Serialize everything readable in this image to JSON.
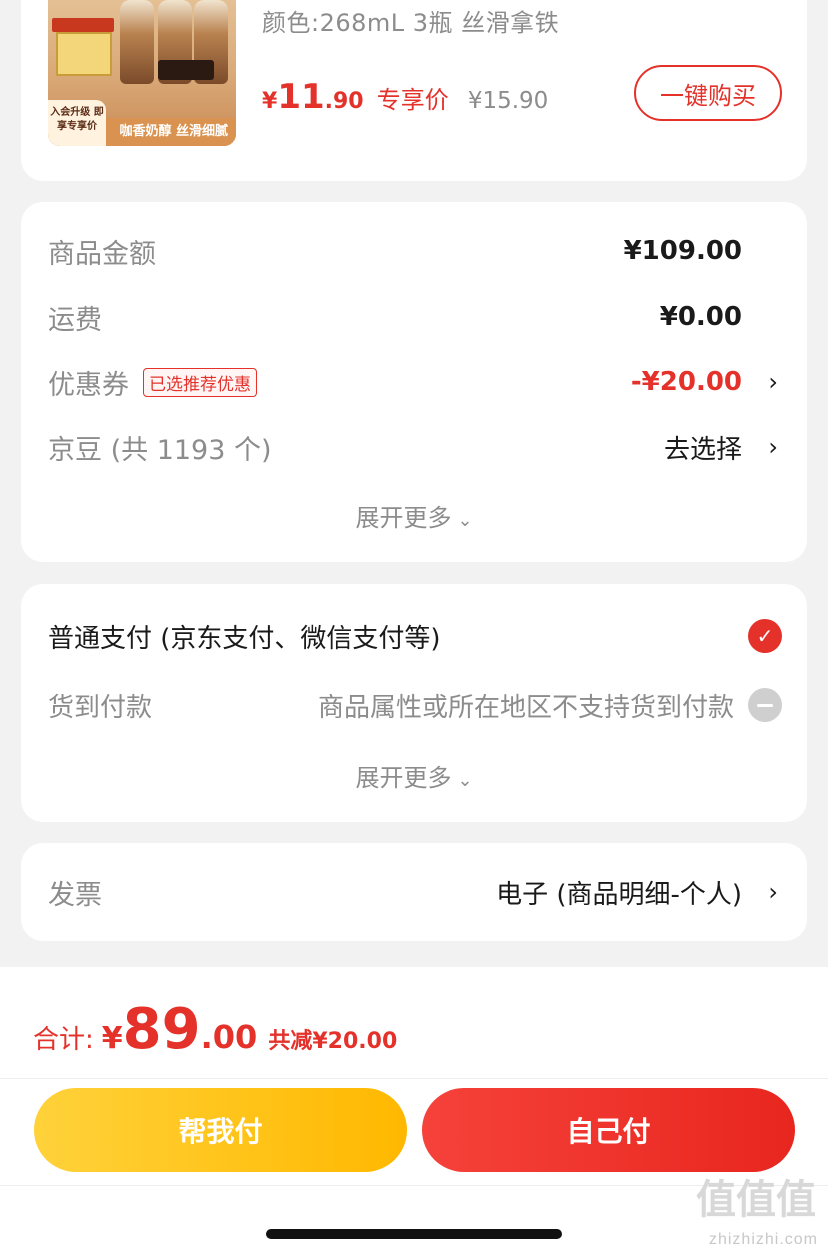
{
  "product": {
    "spec": "颜色:268mL 3瓶  丝滑拿铁",
    "price_currency": "¥",
    "price_int": "11",
    "price_dec": ".90",
    "price_tag": "专享价",
    "orig_price": "¥15.90",
    "buy_button": "一键购买",
    "image_footer": "咖香奶醇 丝滑细腻",
    "image_badge": "入会升级 即享专享价"
  },
  "summary": {
    "goods_label": "商品金额",
    "goods_value": "¥109.00",
    "shipping_label": "运费",
    "shipping_value": "¥0.00",
    "coupon_label": "优惠券",
    "coupon_tag": "已选推荐优惠",
    "coupon_value": "-¥20.00",
    "jingdou_label": "京豆 (共 1193 个)",
    "jingdou_value": "去选择",
    "expand": "展开更多"
  },
  "payment": {
    "normal_label": "普通支付 (京东支付、微信支付等)",
    "cod_label": "货到付款",
    "cod_note": "商品属性或所在地区不支持货到付款",
    "expand": "展开更多"
  },
  "invoice": {
    "label": "发票",
    "value": "电子 (商品明细-个人)"
  },
  "bottom": {
    "total_label": "合计:",
    "total_currency": "¥",
    "total_int": "89",
    "total_dec": ".00",
    "saved": "共减¥20.00",
    "help_pay": "帮我付",
    "self_pay": "自己付"
  },
  "watermark": {
    "logo": "值值值",
    "url": "zhizhizhi.com"
  },
  "icons": {
    "chevron": "chevron-right-icon",
    "check": "check-circle-icon",
    "disabled": "minus-circle-icon",
    "caret": "chevron-down-icon"
  },
  "colors": {
    "accent": "#e4322b",
    "help_button": "#ffc21a",
    "self_button": "#ef3a31"
  }
}
